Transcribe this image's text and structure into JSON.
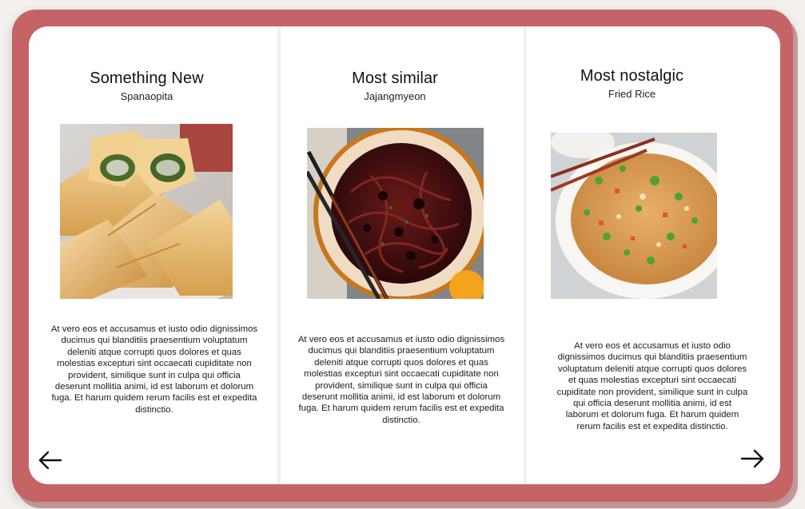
{
  "cards": [
    {
      "title": "Something New",
      "subtitle": "Spanaopita",
      "image_name": "spanakopita-photo",
      "description": "At vero eos et accusamus et iusto odio dignissimos ducimus qui blanditiis praesentium voluptatum deleniti atque corrupti quos dolores et quas molestias excepturi sint occaecati cupiditate non provident, similique sunt in culpa qui officia deserunt mollitia animi, id est laborum et dolorum fuga. Et harum quidem rerum facilis est et expedita distinctio."
    },
    {
      "title": "Most similar",
      "subtitle": "Jajangmyeon",
      "image_name": "jajangmyeon-photo",
      "description": "At vero eos et accusamus et iusto odio dignissimos ducimus qui blanditiis praesentium voluptatum deleniti atque corrupti quos dolores et quas molestias excepturi sint occaecati cupiditate non provident, similique sunt in culpa qui officia deserunt mollitia animi, id est laborum et dolorum fuga. Et harum quidem rerum facilis est et expedita distinctio."
    },
    {
      "title": "Most nostalgic",
      "subtitle": "Fried Rice",
      "image_name": "fried-rice-photo",
      "description": "At vero eos et accusamus et iusto odio dignissimos ducimus qui blanditiis praesentium voluptatum deleniti atque corrupti quos dolores et quas molestias excepturi sint occaecati cupiditate non provident, similique sunt in culpa qui officia deserunt mollitia animi, id est laborum et dolorum fuga. Et harum quidem rerum facilis est et expedita distinctio."
    }
  ],
  "navigation": {
    "prev_icon": "arrow-left-icon",
    "next_icon": "arrow-right-icon"
  },
  "colors": {
    "frame": "#c66366",
    "panel": "#ffffff",
    "text": "#111111"
  }
}
